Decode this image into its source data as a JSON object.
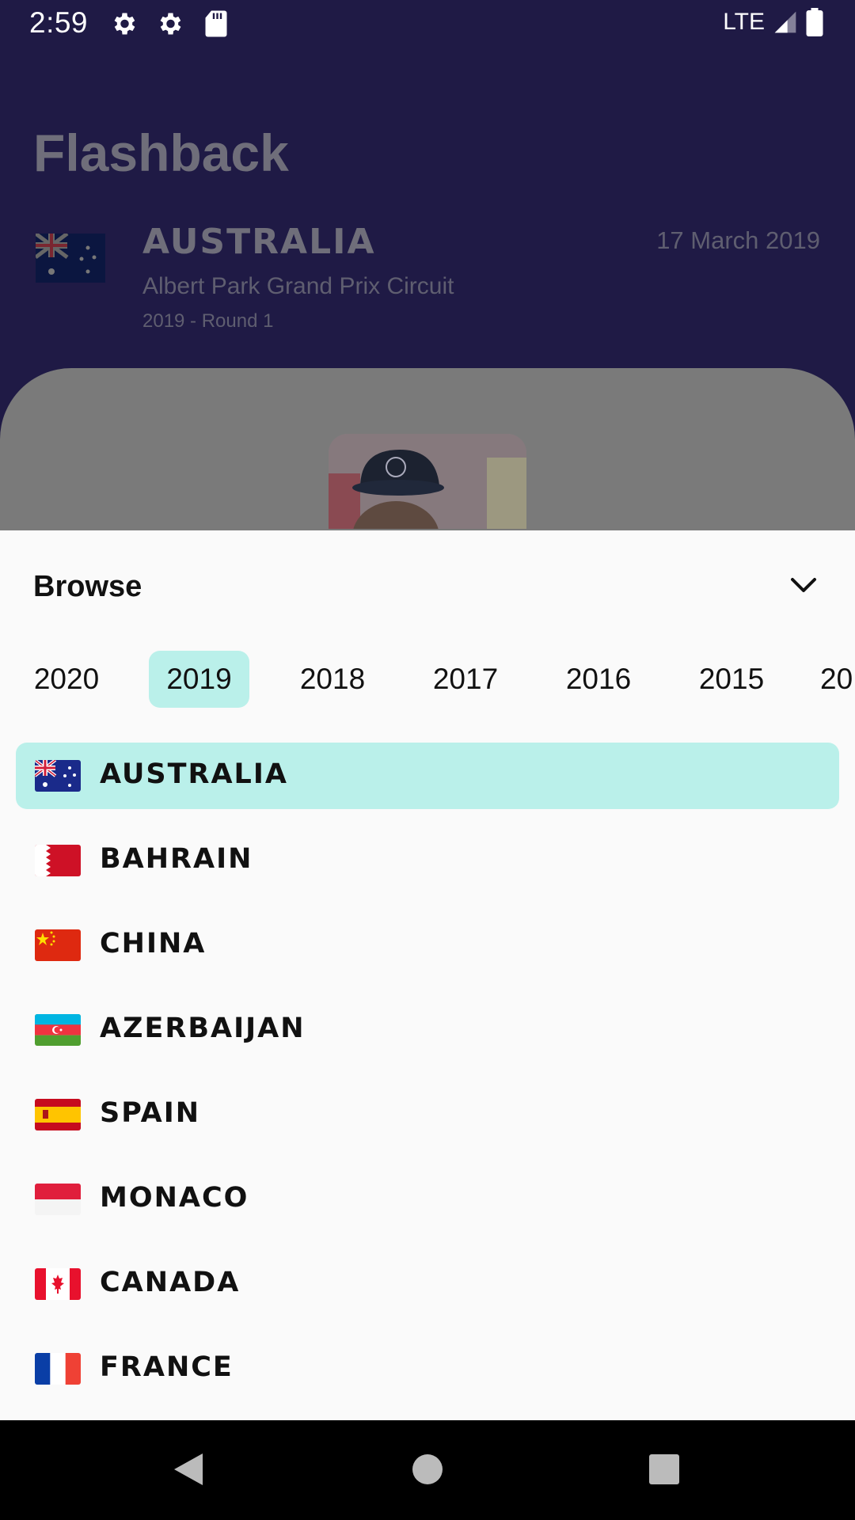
{
  "status_bar": {
    "time": "2:59",
    "network": "LTE",
    "icons": [
      "gear-icon",
      "gear-icon",
      "sd-card-icon",
      "signal-icon",
      "battery-icon"
    ]
  },
  "header": {
    "title": "Flashback",
    "race": {
      "country": "AUSTRALIA",
      "circuit": "Albert Park Grand Prix Circuit",
      "round": "2019 - Round 1",
      "date": "17 March 2019"
    }
  },
  "sheet": {
    "title": "Browse",
    "years": [
      "2020",
      "2019",
      "2018",
      "2017",
      "2016",
      "2015",
      "20"
    ],
    "selected_year": "2019",
    "races": [
      {
        "name": "AUSTRALIA",
        "flag": "australia-flag",
        "selected": true
      },
      {
        "name": "BAHRAIN",
        "flag": "bahrain-flag",
        "selected": false
      },
      {
        "name": "CHINA",
        "flag": "china-flag",
        "selected": false
      },
      {
        "name": "AZERBAIJAN",
        "flag": "azerbaijan-flag",
        "selected": false
      },
      {
        "name": "SPAIN",
        "flag": "spain-flag",
        "selected": false
      },
      {
        "name": "MONACO",
        "flag": "monaco-flag",
        "selected": false
      },
      {
        "name": "CANADA",
        "flag": "canada-flag",
        "selected": false
      },
      {
        "name": "FRANCE",
        "flag": "france-flag",
        "selected": false
      }
    ]
  },
  "colors": {
    "header_bg": "#1f1a45",
    "selected_bg": "#baf0ea",
    "sheet_bg": "#fafafa"
  }
}
